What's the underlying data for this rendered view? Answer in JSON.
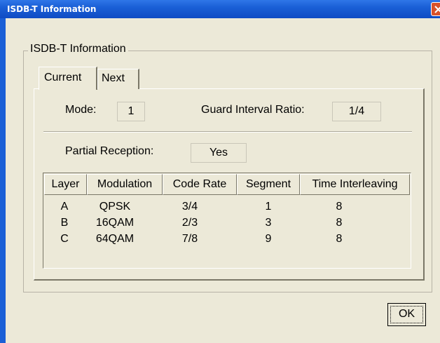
{
  "window": {
    "title": "ISDB-T Information"
  },
  "group": {
    "label": "ISDB-T Information"
  },
  "tabs": [
    {
      "label": "Current"
    },
    {
      "label": "Next"
    }
  ],
  "fields": {
    "mode_label": "Mode:",
    "mode_value": "1",
    "guard_label": "Guard Interval Ratio:",
    "guard_value": "1/4",
    "partial_label": "Partial Reception:",
    "partial_value": "Yes"
  },
  "table": {
    "headers": [
      "Layer",
      "Modulation",
      "Code Rate",
      "Segment",
      "Time Interleaving"
    ],
    "rows": [
      [
        "A",
        "QPSK",
        "3/4",
        "1",
        "8"
      ],
      [
        "B",
        "16QAM",
        "2/3",
        "3",
        "8"
      ],
      [
        "C",
        "64QAM",
        "7/8",
        "9",
        "8"
      ]
    ]
  },
  "buttons": {
    "ok": "OK"
  },
  "colors": {
    "titlebar": "#1a5fd6",
    "dialog_bg": "#ece9d8",
    "close_button": "#d9522a"
  }
}
